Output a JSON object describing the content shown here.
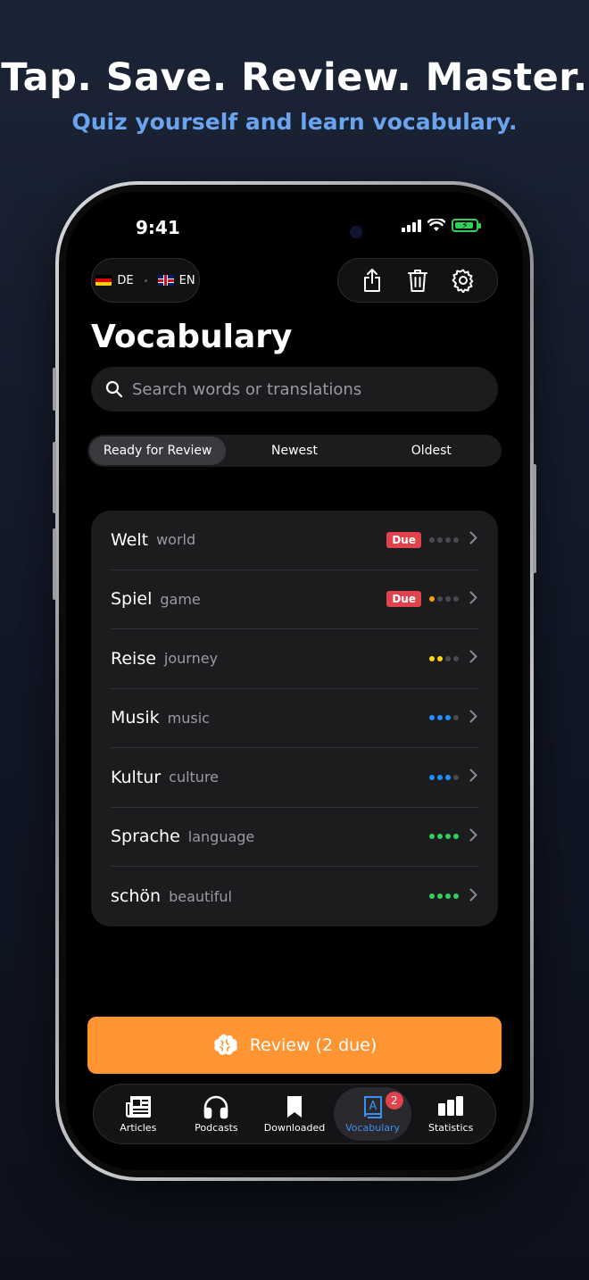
{
  "marketing": {
    "headline": "Tap. Save. Review. Master.",
    "subline": "Quiz yourself and learn vocabulary."
  },
  "statusbar": {
    "time": "9:41"
  },
  "languages": {
    "source": "DE",
    "target": "EN"
  },
  "page": {
    "title": "Vocabulary"
  },
  "search": {
    "placeholder": "Search words or translations"
  },
  "sort_tabs": [
    {
      "label": "Ready for Review",
      "active": true
    },
    {
      "label": "Newest",
      "active": false
    },
    {
      "label": "Oldest",
      "active": false
    }
  ],
  "vocab": [
    {
      "word": "Welt",
      "translation": "world",
      "due": true,
      "due_label": "Due",
      "level": 0,
      "color": "#4a4a4e"
    },
    {
      "word": "Spiel",
      "translation": "game",
      "due": true,
      "due_label": "Due",
      "level": 1,
      "color": "#ff9f0a"
    },
    {
      "word": "Reise",
      "translation": "journey",
      "due": false,
      "due_label": "",
      "level": 2,
      "color": "#ffd60a"
    },
    {
      "word": "Musik",
      "translation": "music",
      "due": false,
      "due_label": "",
      "level": 3,
      "color": "#1e90ff"
    },
    {
      "word": "Kultur",
      "translation": "culture",
      "due": false,
      "due_label": "",
      "level": 3,
      "color": "#1e90ff"
    },
    {
      "word": "Sprache",
      "translation": "language",
      "due": false,
      "due_label": "",
      "level": 4,
      "color": "#30d158"
    },
    {
      "word": "schön",
      "translation": "beautiful",
      "due": false,
      "due_label": "",
      "level": 4,
      "color": "#30d158"
    }
  ],
  "review_button": {
    "label": "Review (2 due)"
  },
  "tabbar": {
    "items": [
      {
        "label": "Articles",
        "icon": "newspaper-icon"
      },
      {
        "label": "Podcasts",
        "icon": "headphones-icon"
      },
      {
        "label": "Downloaded",
        "icon": "bookmark-icon"
      },
      {
        "label": "Vocabulary",
        "icon": "dictionary-icon",
        "badge": "2",
        "active": true
      },
      {
        "label": "Statistics",
        "icon": "bar-chart-icon"
      }
    ]
  },
  "colors": {
    "accent": "#ff9433",
    "active_tab": "#3b8ff0",
    "due": "#e0434b"
  }
}
